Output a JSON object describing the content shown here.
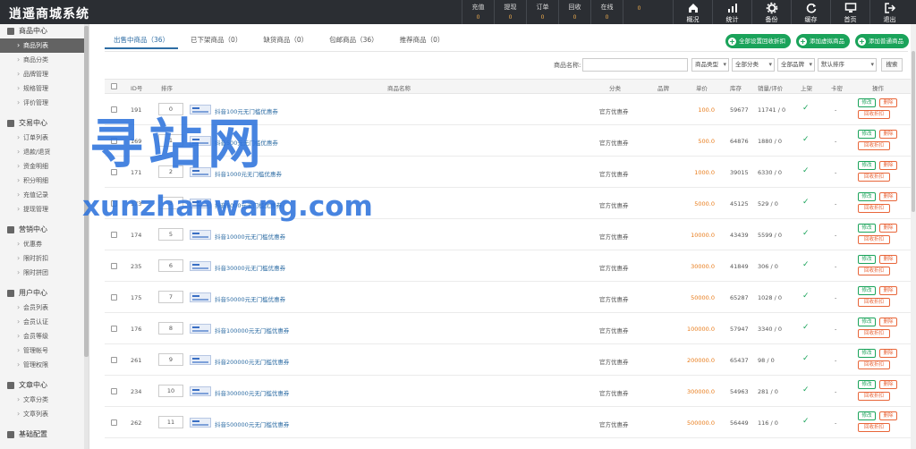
{
  "app": {
    "title": "逍遥商城系统"
  },
  "stats": [
    {
      "label": "充值",
      "value": "0"
    },
    {
      "label": "提现",
      "value": "0"
    },
    {
      "label": "订单",
      "value": "0"
    },
    {
      "label": "回收",
      "value": "0"
    },
    {
      "label": "在线",
      "value": "0"
    },
    {
      "label": "",
      "value": "0"
    }
  ],
  "tools": [
    {
      "label": "概况",
      "icon": "home-icon"
    },
    {
      "label": "统计",
      "icon": "bar-chart-icon"
    },
    {
      "label": "备份",
      "icon": "gear-icon"
    },
    {
      "label": "缓存",
      "icon": "refresh-icon"
    },
    {
      "label": "首页",
      "icon": "monitor-icon"
    },
    {
      "label": "退出",
      "icon": "logout-icon"
    }
  ],
  "sidebar": {
    "groups": [
      {
        "title": "商品中心",
        "items": [
          "商品列表",
          "商品分类",
          "品牌管理",
          "规格管理",
          "评价管理"
        ]
      },
      {
        "title": "交易中心",
        "items": [
          "订单列表",
          "退款/退货",
          "资金明细",
          "积分明细",
          "充值记录",
          "提现管理"
        ]
      },
      {
        "title": "营销中心",
        "items": [
          "优惠券",
          "限时折扣",
          "限时拼团"
        ]
      },
      {
        "title": "用户中心",
        "items": [
          "会员列表",
          "会员认证",
          "会员等级",
          "管理帐号",
          "管理权限"
        ]
      },
      {
        "title": "文章中心",
        "items": [
          "文章分类",
          "文章列表"
        ]
      },
      {
        "title": "基础配置",
        "items": []
      }
    ]
  },
  "tabs": [
    {
      "label": "出售中商品（36）"
    },
    {
      "label": "已下架商品（0）"
    },
    {
      "label": "缺货商品（0）"
    },
    {
      "label": "包邮商品（36）"
    },
    {
      "label": "推荐商品（0）"
    }
  ],
  "actions": [
    "全部设置回收折扣",
    "添加虚拟商品",
    "添加普通商品"
  ],
  "search": {
    "label": "商品名称:",
    "input_value": "",
    "type_select": "商品类型",
    "category_select": "全部分类",
    "brand_select": "全部品牌",
    "sort_select": "默认排序",
    "button": "搜索"
  },
  "table": {
    "headers": {
      "id": "ID号",
      "sort": "排序",
      "name": "商品名称",
      "category": "分类",
      "brand": "品牌",
      "price": "单价",
      "stock": "库存",
      "sales": "销量/评价",
      "listed": "上架",
      "card": "卡密",
      "ops": "操作"
    },
    "op_labels": {
      "edit": "修改",
      "delete": "删除",
      "recycle": "回收折扣"
    },
    "rows": [
      {
        "id": "191",
        "sort": "0",
        "name": "抖音100元无门槛优惠券",
        "category": "官方优惠券",
        "brand": "",
        "price": "100.0",
        "stock": "59677",
        "sales": "11741 / 0",
        "card": "-"
      },
      {
        "id": "169",
        "sort": "1",
        "name": "抖音500元无门槛优惠券",
        "category": "官方优惠券",
        "brand": "",
        "price": "500.0",
        "stock": "64876",
        "sales": "1880 / 0",
        "card": "-"
      },
      {
        "id": "171",
        "sort": "2",
        "name": "抖音1000元无门槛优惠券",
        "category": "官方优惠券",
        "brand": "",
        "price": "1000.0",
        "stock": "39015",
        "sales": "6330 / 0",
        "card": "-"
      },
      {
        "id": "173",
        "sort": "3",
        "name": "抖音5000元无门槛优惠券",
        "category": "官方优惠券",
        "brand": "",
        "price": "5000.0",
        "stock": "45125",
        "sales": "529 / 0",
        "card": "-"
      },
      {
        "id": "174",
        "sort": "5",
        "name": "抖音10000元无门槛优惠券",
        "category": "官方优惠券",
        "brand": "",
        "price": "10000.0",
        "stock": "43439",
        "sales": "5599 / 0",
        "card": "-"
      },
      {
        "id": "235",
        "sort": "6",
        "name": "抖音30000元无门槛优惠券",
        "category": "官方优惠券",
        "brand": "",
        "price": "30000.0",
        "stock": "41849",
        "sales": "306 / 0",
        "card": "-"
      },
      {
        "id": "175",
        "sort": "7",
        "name": "抖音50000元无门槛优惠券",
        "category": "官方优惠券",
        "brand": "",
        "price": "50000.0",
        "stock": "65287",
        "sales": "1028 / 0",
        "card": "-"
      },
      {
        "id": "176",
        "sort": "8",
        "name": "抖音100000元无门槛优惠券",
        "category": "官方优惠券",
        "brand": "",
        "price": "100000.0",
        "stock": "57947",
        "sales": "3340 / 0",
        "card": "-"
      },
      {
        "id": "261",
        "sort": "9",
        "name": "抖音200000元无门槛优惠券",
        "category": "官方优惠券",
        "brand": "",
        "price": "200000.0",
        "stock": "65437",
        "sales": "98 / 0",
        "card": "-"
      },
      {
        "id": "234",
        "sort": "10",
        "name": "抖音300000元无门槛优惠券",
        "category": "官方优惠券",
        "brand": "",
        "price": "300000.0",
        "stock": "54963",
        "sales": "281 / 0",
        "card": "-"
      },
      {
        "id": "262",
        "sort": "11",
        "name": "抖音500000元无门槛优惠券",
        "category": "官方优惠券",
        "brand": "",
        "price": "500000.0",
        "stock": "56449",
        "sales": "116 / 0",
        "card": "-"
      }
    ]
  },
  "watermark": {
    "line1": "寻站网",
    "line2": "xunzhanwang.com"
  },
  "colors": {
    "topbar": "#2b2e33",
    "accent_green": "#1aa35a",
    "price_orange": "#e87b1a",
    "link_blue": "#2e6da4",
    "watermark_blue": "#2d73dc"
  }
}
